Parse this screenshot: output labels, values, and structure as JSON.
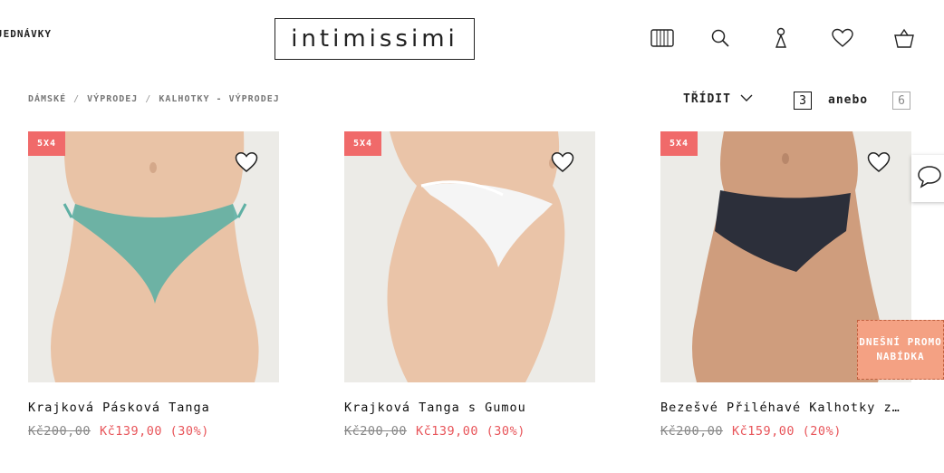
{
  "header": {
    "nav_link": "JEDNÁVKY",
    "logo": "intimissimi",
    "icons": [
      "store-icon",
      "search-icon",
      "account-icon",
      "wishlist-icon",
      "bag-icon"
    ]
  },
  "breadcrumb": [
    "DÁMSKÉ",
    "VÝPRODEJ",
    "KALHOTKY - VÝPRODEJ"
  ],
  "toolbar": {
    "sort_label": "TŘÍDIT",
    "grid_small": "3",
    "grid_or": "anebo",
    "grid_large": "6"
  },
  "products": [
    {
      "badge": "5X4",
      "name": "Krajková Pásková Tanga",
      "old_price": "Kč200,00",
      "new_price": "Kč139,00 (30%)",
      "color": "#5fb0a4"
    },
    {
      "badge": "5X4",
      "name": "Krajková Tanga s Gumou",
      "old_price": "Kč200,00",
      "new_price": "Kč139,00 (30%)",
      "color": "#f5f5f5"
    },
    {
      "badge": "5X4",
      "name": "Bezešvé Přiléhavé Kalhotky z…",
      "old_price": "Kč200,00",
      "new_price": "Kč159,00 (20%)",
      "color": "#2c2f3a"
    }
  ],
  "promo": {
    "label": "DNEŠNÍ PROMO NABÍDKA"
  },
  "colors": {
    "accent": "#f06a6a",
    "sale": "#e8555a",
    "promo": "#f4a183"
  }
}
